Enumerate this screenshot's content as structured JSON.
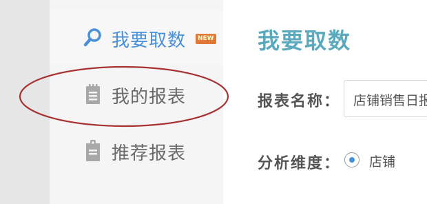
{
  "sidebar": {
    "items": [
      {
        "label": "我要取数",
        "icon": "search-icon",
        "active": true,
        "badge": "NEW"
      },
      {
        "label": "我的报表",
        "icon": "notepad-icon",
        "active": false
      },
      {
        "label": "推荐报表",
        "icon": "clipboard-icon",
        "active": false
      }
    ]
  },
  "main": {
    "title": "我要取数",
    "report_name": {
      "label": "报表名称：",
      "value": "店铺销售日报"
    },
    "dimension": {
      "label": "分析维度：",
      "selected_option": "店铺"
    }
  },
  "colors": {
    "accent_blue": "#4a90d9",
    "title_teal": "#5aa9bd",
    "active_bar": "#8cc466",
    "badge_bg": "#e0793a",
    "annotation_red": "#a83232"
  }
}
